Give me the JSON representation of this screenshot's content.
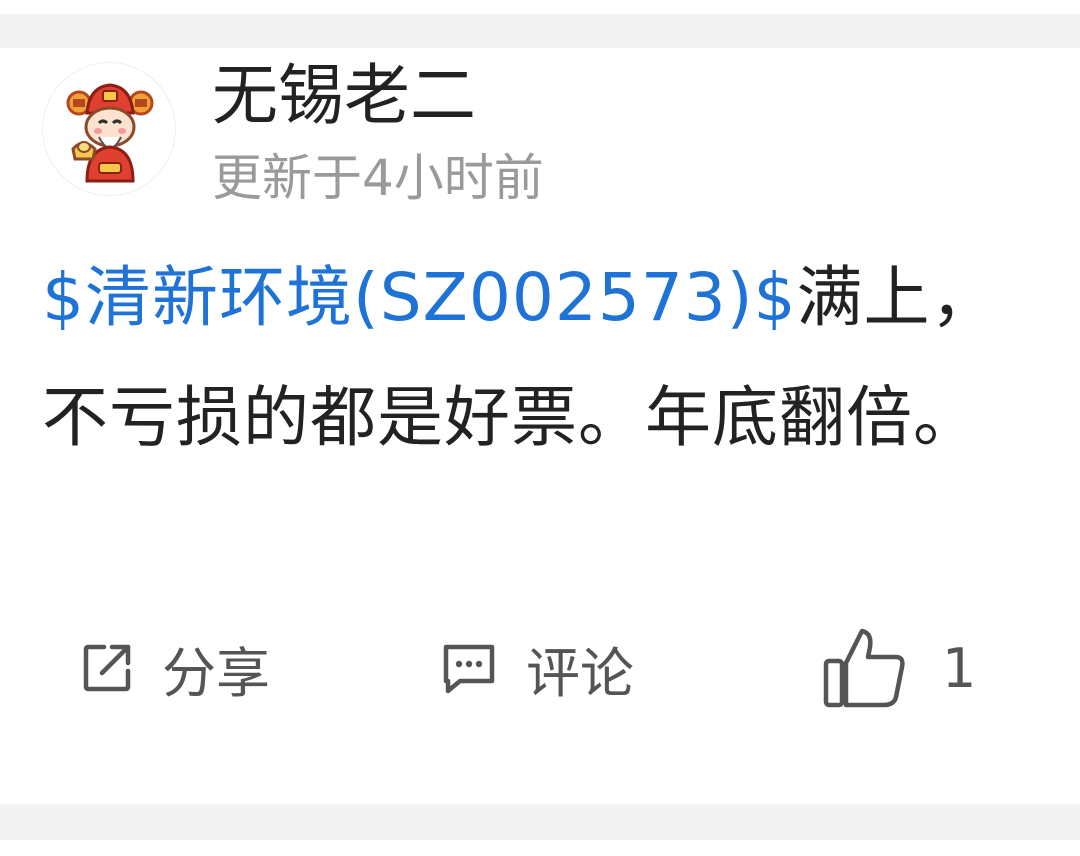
{
  "post": {
    "author": "无锡老二",
    "updated_text": "更新于4小时前",
    "stock_tag": "$清新环境(SZ002573)$",
    "content": "满上，不亏损的都是好票。年底翻倍。"
  },
  "actions": {
    "share_label": "分享",
    "comment_label": "评论",
    "like_count": "1"
  },
  "colors": {
    "link": "#1f73d6",
    "text": "#222222",
    "muted": "#9a9a9a",
    "icon": "#555555"
  },
  "icons": {
    "avatar": "fortune-god-avatar",
    "share": "share-external-icon",
    "comment": "comment-bubble-icon",
    "like": "thumbs-up-icon"
  }
}
